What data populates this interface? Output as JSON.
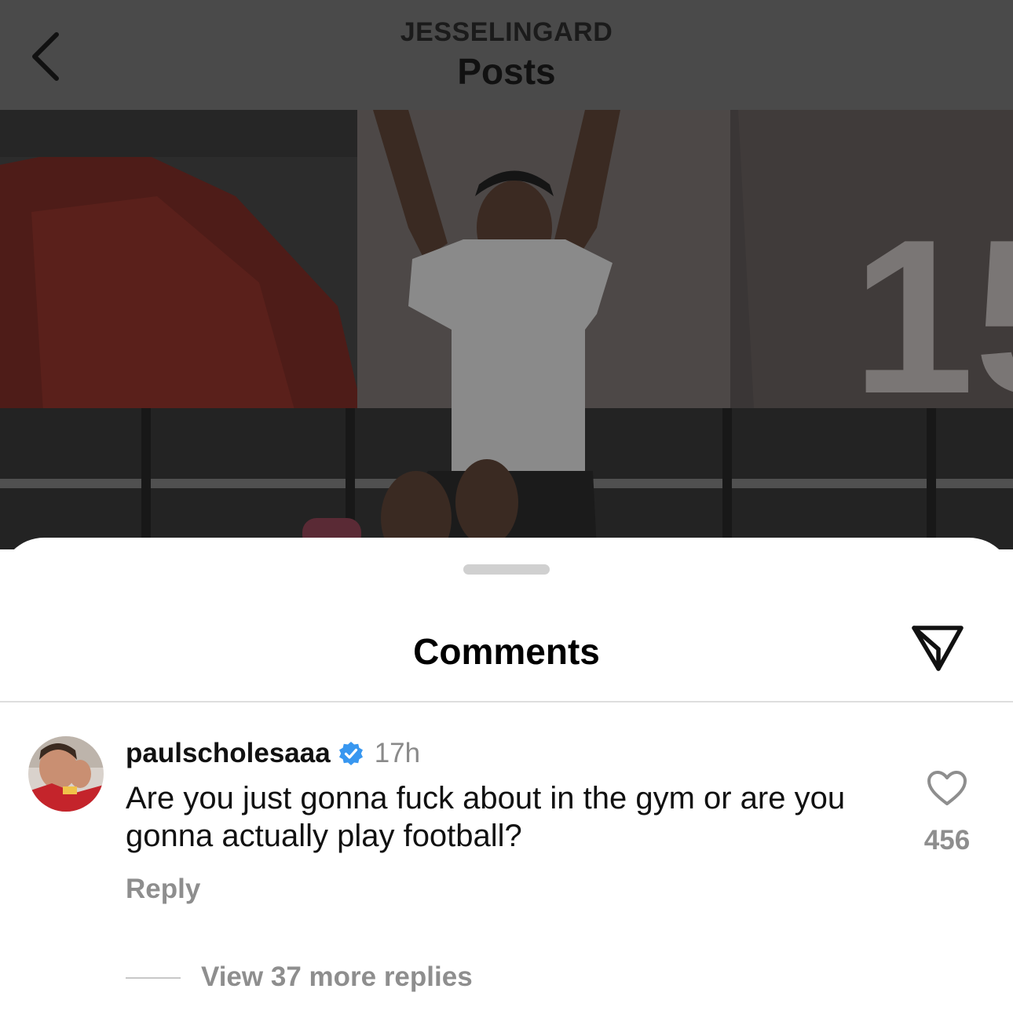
{
  "header": {
    "username": "JESSELINGARD",
    "title": "Posts"
  },
  "post": {
    "jersey_number": "15"
  },
  "comments_sheet": {
    "title": "Comments"
  },
  "comment": {
    "username": "paulscholesaaa",
    "verified": true,
    "time": "17h",
    "text": "Are you just gonna fuck about in the gym or are you gonna actually play football?",
    "reply_label": "Reply",
    "like_count": "456",
    "view_replies_label": "View 37 more replies"
  },
  "icons": {
    "back": "chevron-left-icon",
    "share": "paper-plane-icon",
    "like": "heart-icon",
    "verified": "verified-badge-icon"
  },
  "colors": {
    "header_bg": "#4a4a4a",
    "verified_blue": "#3897f0",
    "secondary_text": "#8e8e8e"
  }
}
